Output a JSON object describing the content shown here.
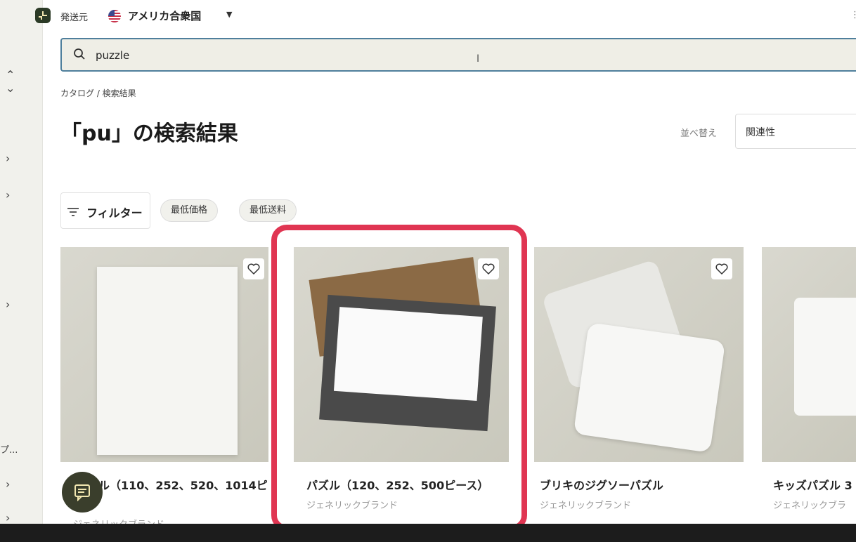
{
  "topbar": {
    "ship_from_label": "発送元",
    "country": "アメリカ合衆国",
    "more": "⋮"
  },
  "search": {
    "value": "puzzle"
  },
  "breadcrumb": "カタログ / 検索結果",
  "page_title": "「pu」の検索結果",
  "sort": {
    "label": "並べ替え",
    "value": "関連性"
  },
  "filters": {
    "button": "フィルター",
    "chips": [
      "最低価格",
      "最低送料"
    ]
  },
  "sidebar": {
    "truncated_label": "プ..."
  },
  "products": [
    {
      "name": "ル（110、252、520、1014ピ",
      "brand": "ジェネリックブランド"
    },
    {
      "name": "パズル（120、252、500ピース）",
      "brand": "ジェネリックブランド"
    },
    {
      "name": "ブリキのジグソーパズル",
      "brand": "ジェネリックブランド"
    },
    {
      "name": "キッズパズル 3",
      "brand": "ジェネリックブラ"
    }
  ],
  "colors": {
    "accent": "#e03552",
    "search_border": "#4f7f9c",
    "brand_dark": "#2b3a26"
  }
}
